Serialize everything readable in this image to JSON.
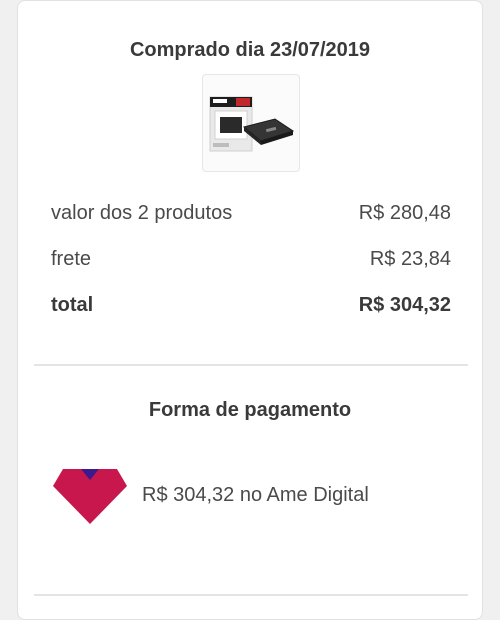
{
  "purchase": {
    "title": "Comprado dia 23/07/2019"
  },
  "product": {
    "icon": "ssd-product-icon"
  },
  "summary": {
    "rows": [
      {
        "label": "valor dos 2 produtos",
        "value": "R$ 280,48"
      },
      {
        "label": "frete",
        "value": "R$ 23,84"
      }
    ],
    "total": {
      "label": "total",
      "value": "R$ 304,32"
    }
  },
  "payment": {
    "title": "Forma de pagamento",
    "description": "R$ 304,32 no Ame Digital",
    "icon": "ame-digital-logo-icon",
    "colors": {
      "logo_red": "#c8174d",
      "logo_purple": "#3c1a8a"
    }
  }
}
